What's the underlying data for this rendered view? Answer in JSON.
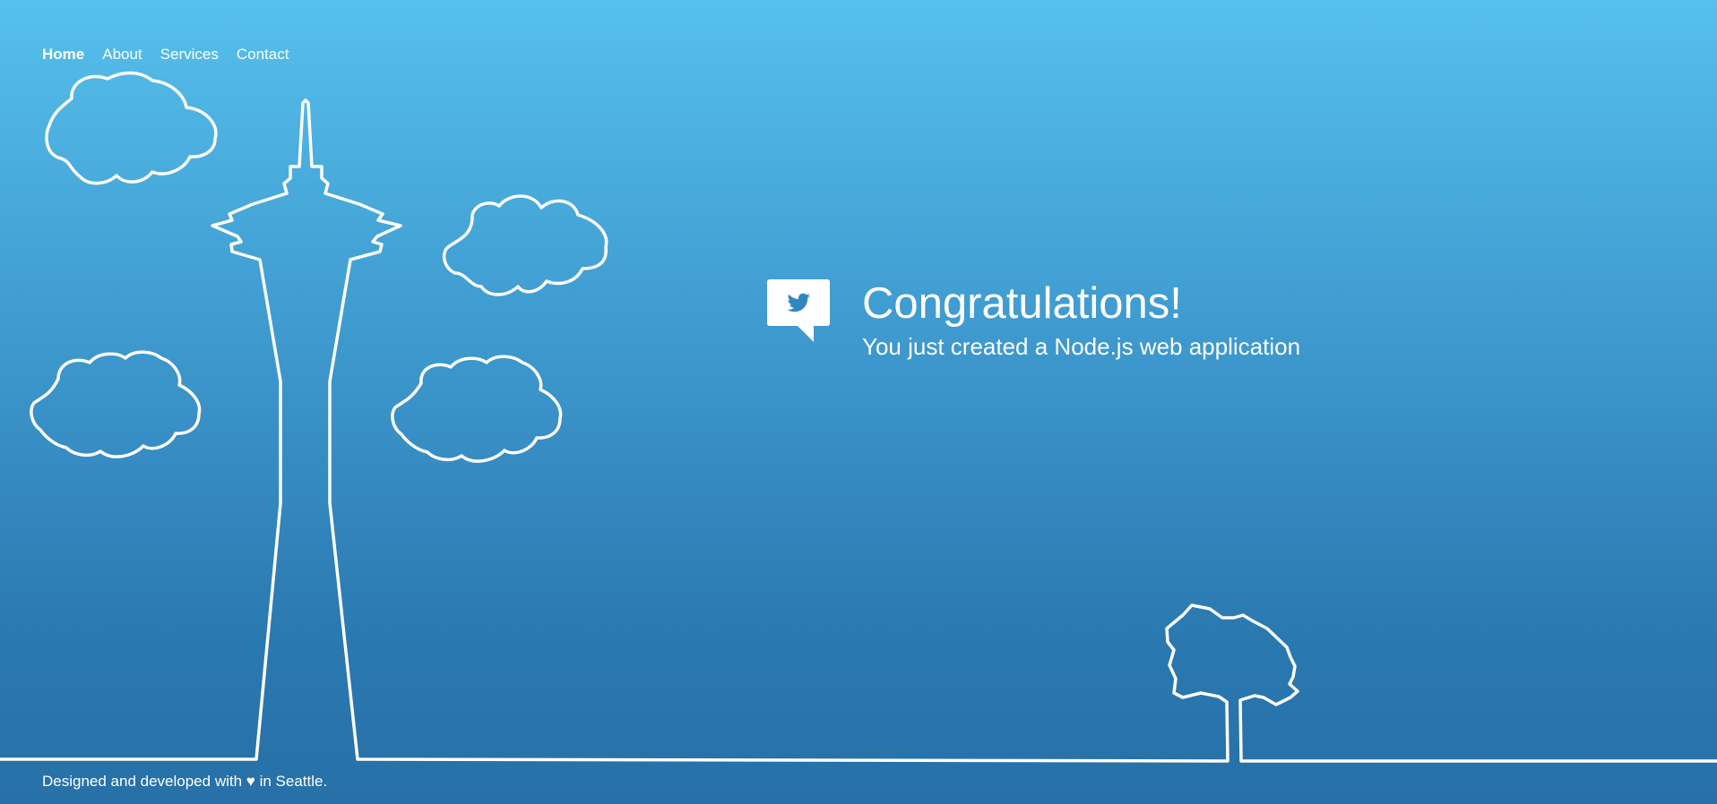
{
  "nav": {
    "items": [
      {
        "label": "Home",
        "active": true
      },
      {
        "label": "About",
        "active": false
      },
      {
        "label": "Services",
        "active": false
      },
      {
        "label": "Contact",
        "active": false
      }
    ]
  },
  "hero": {
    "icon": "twitter-bird-speech-bubble-icon",
    "title": "Congratulations!",
    "subtitle": "You just created a Node.js web application"
  },
  "footer": {
    "text": "Designed and developed with ♥ in Seattle."
  },
  "colors": {
    "sky_top": "#56c0ec",
    "sky_bottom": "#2870a8",
    "line": "#ffffff"
  }
}
